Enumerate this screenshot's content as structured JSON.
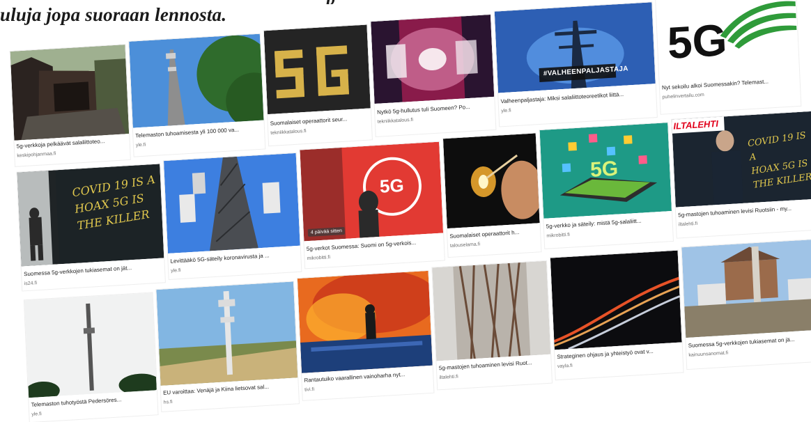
{
  "article": {
    "headline_line": "uluja jopa suoraan lennosta.",
    "headline_partial_top": "p"
  },
  "results": [
    {
      "caption": "5g-verkkoja pelkäävät salaliittoteo...",
      "source": "keskipohjanmaa.fi"
    },
    {
      "caption": "Telemaston tuhoamisesta yli 100 000 va...",
      "source": "yle.fi"
    },
    {
      "caption": "Suomalaiset operaattorit seur...",
      "source": "tekniikkatalous.fi"
    },
    {
      "caption": "Nytkö 5g-hullutus tuli Suomeen? Po...",
      "source": "tekniikkatalous.fi"
    },
    {
      "caption": "Valheenpaljastaja: Miksi salaliittoteoreetikot liittä...",
      "source": "yle.fi",
      "overlay": "#VALHEENPALJASTAJA"
    },
    {
      "caption": "Nyt sekoilu alkoi Suomessakin? Telemast...",
      "source": "puhelinvertailu.com",
      "logo": "5G"
    },
    {
      "caption": "Suomessa 5g-verkkojen tukiasemat on jät...",
      "source": "is24.fi",
      "graffiti": [
        "COVID 19 IS A",
        "HOAX 5G IS",
        "THE KILLER"
      ]
    },
    {
      "caption": "Levittääkö 5G-säteily koronavirusta ja ...",
      "source": "yle.fi"
    },
    {
      "caption": "5g-verkot Suomessa: Suomi on 5g-verkois...",
      "source": "mikrobitti.fi",
      "badge": "4 päivää sitten",
      "logo": "5G"
    },
    {
      "caption": "Suomalaiset operaattorit h...",
      "source": "talouselama.fi"
    },
    {
      "caption": "5g-verkko ja säteily: mistä 5g-salaliitt...",
      "source": "mikrobitti.fi",
      "logo": "5G"
    },
    {
      "caption": "5g-mastojen tuhoaminen levisi Ruotsiin - my...",
      "source": "iltalehti.fi",
      "brand": "ILTALEHTI",
      "graffiti": [
        "COVID 19 IS A",
        "HOAX 5G IS",
        "THE KILLER"
      ]
    },
    {
      "caption": "Telemaston tuhotyöstä Pedersöres...",
      "source": "yle.fi"
    },
    {
      "caption": "EU varoittaa: Venäjä ja Kiina lietsovat sal...",
      "source": "hs.fi"
    },
    {
      "caption": "Rantautuiko vaarallinen vainoharha nyt...",
      "source": "tivi.fi"
    },
    {
      "caption": "5g-mastojen tuhoaminen levisi Ruot...",
      "source": "iltalehti.fi"
    },
    {
      "caption": "Strateginen ohjaus ja yhteistyö ovat v...",
      "source": "vayla.fi"
    },
    {
      "caption": "Suomessa 5g-verkkojen tukiasemat on jä...",
      "source": "kainuunsanomat.fi"
    }
  ]
}
